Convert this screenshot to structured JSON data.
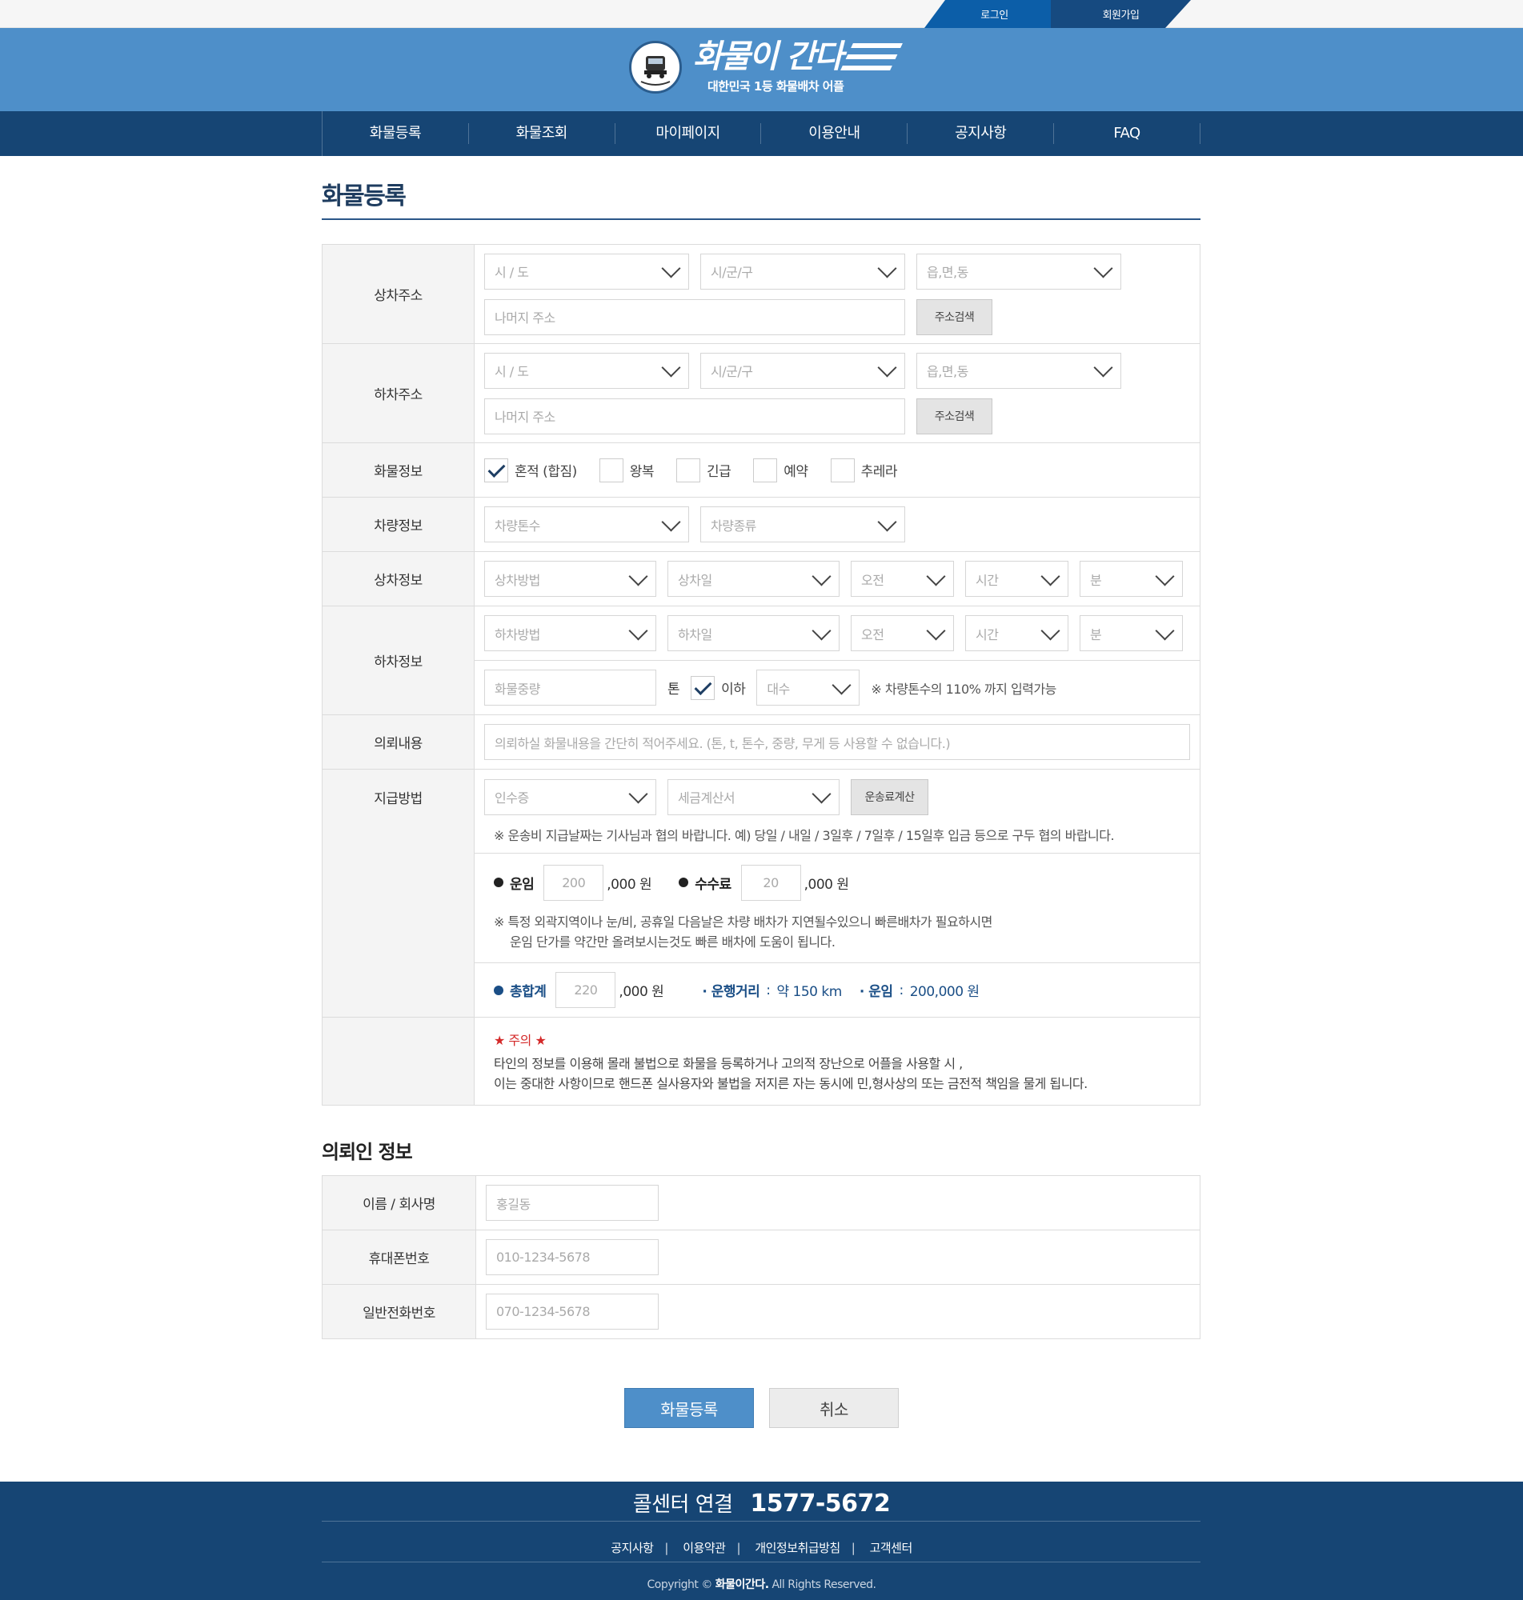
{
  "top": {
    "login": "로그인",
    "join": "회원가입"
  },
  "header": {
    "logo_main": "화물이 간다",
    "logo_sub": "대한민국 1등 화물배차 어플",
    "logo_badge": "화물이간다"
  },
  "nav": [
    "화물등록",
    "화물조회",
    "마이페이지",
    "이용안내",
    "공지사항",
    "FAQ"
  ],
  "page_title": "화물등록",
  "form": {
    "loading_addr": {
      "label": "상차주소",
      "sido": "시 / 도",
      "sigungu": "시/군/구",
      "dong": "읍,면,동",
      "rest": "나머지 주소",
      "search": "주소검색"
    },
    "unloading_addr": {
      "label": "하차주소",
      "sido": "시 / 도",
      "sigungu": "시/군/구",
      "dong": "읍,면,동",
      "rest": "나머지 주소",
      "search": "주소검색"
    },
    "cargo_info": {
      "label": "화물정보",
      "options": [
        {
          "text": "혼적 (합짐)",
          "checked": true
        },
        {
          "text": "왕복",
          "checked": false
        },
        {
          "text": "긴급",
          "checked": false
        },
        {
          "text": "예약",
          "checked": false
        },
        {
          "text": "추레라",
          "checked": false
        }
      ]
    },
    "vehicle_info": {
      "label": "차량정보",
      "tonnage": "차량톤수",
      "type": "차량종류"
    },
    "loading_info": {
      "label": "상차정보",
      "method": "상차방법",
      "date": "상차일",
      "ampm": "오전",
      "hour": "시간",
      "minute": "분"
    },
    "unloading_info": {
      "label": "하차정보",
      "method": "하차방법",
      "date": "하차일",
      "ampm": "오전",
      "hour": "시간",
      "minute": "분",
      "weight": "화물중량",
      "ton": "톤",
      "below": "이하",
      "count": "대수",
      "note": "※ 차량톤수의 110% 까지 입력가능"
    },
    "request": {
      "label": "의뢰내용",
      "placeholder": "의뢰하실 화물내용을 간단히 적어주세요. (톤, t, 톤수, 중량, 무게 등 사용할 수 없습니다.)"
    },
    "payment": {
      "label": "지급방법",
      "receipt": "인수증",
      "tax": "세금계산서",
      "calc": "운송료계산",
      "note": "※ 운송비 지급날짜는 기사님과 협의 바랍니다.   예) 당일 / 내일 / 3일후 / 7일후 / 15일후 입금 등으로 구두 협의 바랍니다.",
      "fare_label": "운임",
      "fare_value": "200",
      "fare_unit": ",000 원",
      "fee_label": "수수료",
      "fee_value": "20",
      "fee_unit": ",000 원",
      "fare_note1": "※ 특정 외곽지역이나 눈/비, 공휴일 다음날은 차량 배차가 지연될수있으니 빠른배차가 필요하시면",
      "fare_note2": "운임 단가를 약간만 올려보시는것도 빠른 배차에 도움이 됩니다.",
      "total_label": "총합계",
      "total_value": "220",
      "total_unit": ",000 원",
      "distance_label": "· 운행거리",
      "distance_value": "약 150 km",
      "fare2_label": "· 운임",
      "fare2_value": "200,000 원"
    },
    "warning": {
      "title": "★ 주의 ★",
      "line1": "타인의 정보를 이용해 몰래 불법으로 화물을 등록하거나 고의적 장난으로 어플을 사용할 시 ,",
      "line2": "이는  중대한 사항이므로 핸드폰 실사용자와 불법을 저지른 자는 동시에 민,형사상의 또는 금전적 책임을 물게 됩니다."
    }
  },
  "requester": {
    "title": "의뢰인 정보",
    "name_label": "이름 / 회사명",
    "name_ph": "홍길동",
    "mobile_label": "휴대폰번호",
    "mobile_ph": "010-1234-5678",
    "phone_label": "일반전화번호",
    "phone_ph": "070-1234-5678"
  },
  "buttons": {
    "submit": "화물등록",
    "cancel": "취소"
  },
  "footer": {
    "call_label": "콜센터 연결",
    "call_number": "1577-5672",
    "links": [
      "공지사항",
      "이용약관",
      "개인정보취급방침",
      "고객센터"
    ],
    "copy_prefix": "Copyright ©",
    "copy_brand": "화물이간다.",
    "copy_suffix": "All Rights Reserved."
  },
  "colors": {
    "primary": "#4e8fc9",
    "navy": "#164574",
    "accent_blue": "#0c5ea8"
  }
}
